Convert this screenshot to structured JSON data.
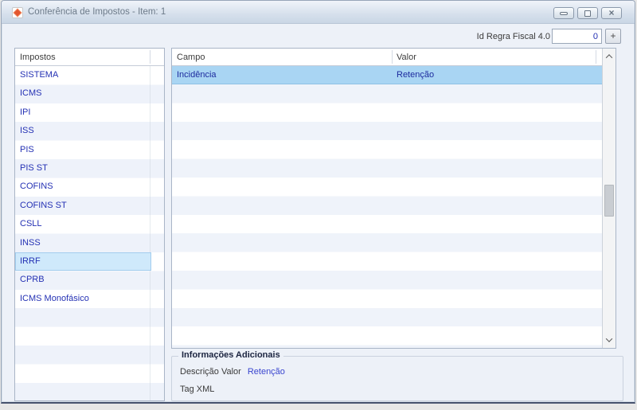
{
  "window": {
    "title": "Conferência de Impostos - Item: 1",
    "controls": {
      "minimize": "minimize",
      "maximize": "maximize",
      "close": "×"
    }
  },
  "toolbar": {
    "id_regra_label": "Id Regra Fiscal 4.0",
    "id_regra_value": "0",
    "add_button_label": "+"
  },
  "left_panel": {
    "header": "Impostos",
    "items": [
      "SISTEMA",
      "ICMS",
      "IPI",
      "ISS",
      "PIS",
      "PIS ST",
      "COFINS",
      "COFINS ST",
      "CSLL",
      "INSS",
      "IRRF",
      "CPRB",
      "ICMS Monofásico"
    ],
    "selected_item": "IRRF"
  },
  "table": {
    "columns": {
      "campo": "Campo",
      "valor": "Valor"
    },
    "rows": [
      {
        "campo": "Incidência",
        "valor": "Retenção"
      }
    ],
    "selected_row_index": 0
  },
  "info_box": {
    "title": "Informações Adicionais",
    "fields": [
      {
        "label": "Descrição Valor",
        "value": "Retenção"
      },
      {
        "label": "Tag XML",
        "value": ""
      }
    ]
  },
  "colors": {
    "accent_selection_strong": "#a9d5f3",
    "accent_selection_light": "#cfe9fb",
    "item_text_blue": "#2431b4",
    "value_link_blue": "#3945cf",
    "stripe": "#eef2fa",
    "titlebar_top": "#f0f4fa",
    "titlebar_bottom": "#c9d6e5",
    "app_icon_orange": "#e2552e"
  }
}
